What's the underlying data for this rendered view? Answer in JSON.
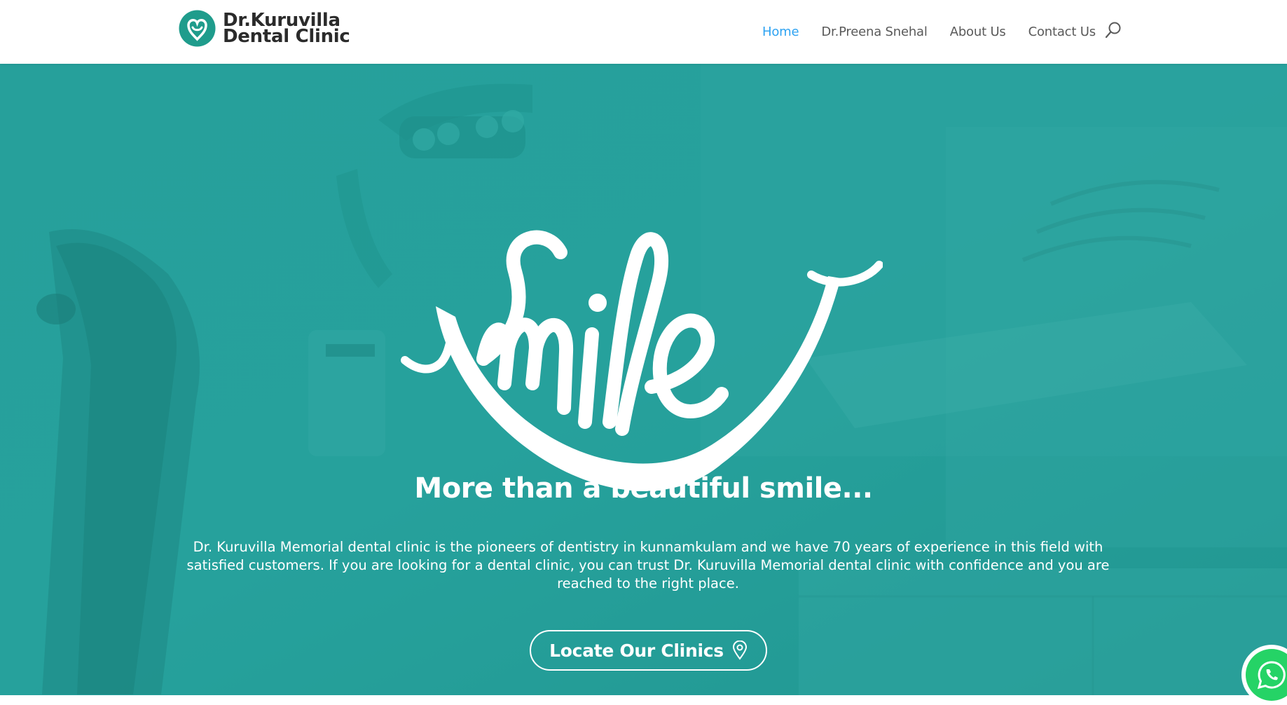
{
  "header": {
    "logo": {
      "line1": "Dr.Kuruvilla",
      "line2": "Dental Clinic",
      "icon": "tooth-heart-icon"
    },
    "nav": [
      {
        "label": "Home",
        "active": true
      },
      {
        "label": "Dr.Preena Snehal",
        "active": false
      },
      {
        "label": "About Us",
        "active": false
      },
      {
        "label": "Contact Us",
        "active": false
      }
    ],
    "search_icon": "search-icon"
  },
  "hero": {
    "logo_word": "Smile",
    "tagline": "More than a beautiful smile...",
    "description": "Dr. Kuruvilla Memorial dental clinic is the pioneers of dentistry in kunnamkulam and we have 70 years of experience in this field with satisfied customers. If you are looking for a dental clinic, you can trust Dr. Kuruvilla Memorial dental clinic with confidence and you are reached to the right place.",
    "cta": {
      "label": "Locate Our Clinics",
      "icon": "map-pin-icon"
    },
    "background": "dental-chair-photo"
  },
  "floating": {
    "whatsapp_icon": "whatsapp-icon"
  },
  "colors": {
    "brand_teal": "#279e9a",
    "nav_active": "#2ea3f2",
    "nav_text": "#5a5a5a",
    "whatsapp_green": "#25d366",
    "logo_dark": "#2b2b2b"
  }
}
